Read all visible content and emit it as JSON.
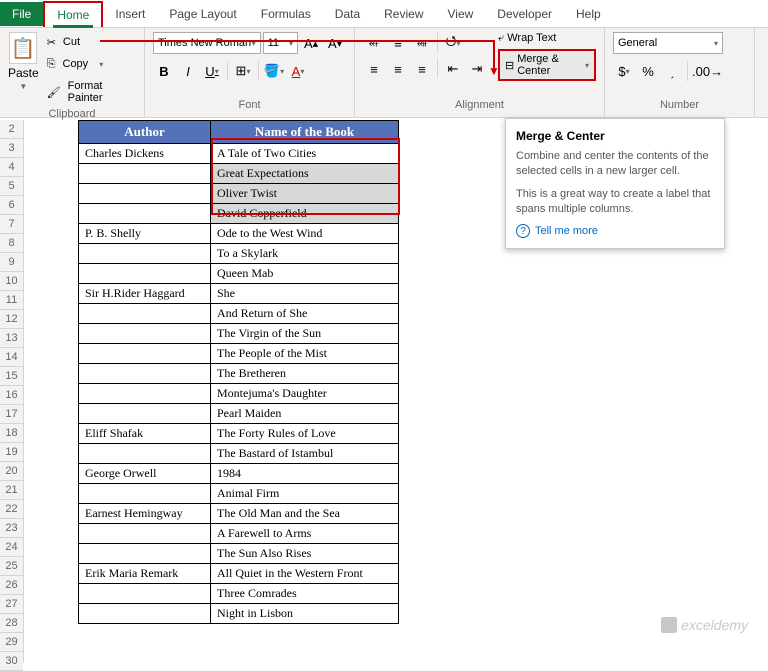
{
  "tabs": {
    "file": "File",
    "home": "Home",
    "insert": "Insert",
    "pagelayout": "Page Layout",
    "formulas": "Formulas",
    "data": "Data",
    "review": "Review",
    "view": "View",
    "developer": "Developer",
    "help": "Help"
  },
  "ribbon": {
    "clipboard": {
      "paste": "Paste",
      "cut": "Cut",
      "copy": "Copy",
      "fmtpainter": "Format Painter",
      "label": "Clipboard"
    },
    "font": {
      "name": "Times New Roman",
      "size": "11",
      "label": "Font"
    },
    "alignment": {
      "wraptext": "Wrap Text",
      "merge": "Merge & Center",
      "label": "Alignment"
    },
    "number": {
      "format": "General",
      "label": "Number"
    }
  },
  "tooltip": {
    "title": "Merge & Center",
    "line1": "Combine and center the contents of the selected cells in a new larger cell.",
    "line2": "This is a great way to create a label that spans multiple columns.",
    "tellmore": "Tell me more"
  },
  "table": {
    "h1": "Author",
    "h2": "Name of the Book",
    "rows": [
      [
        "Charles Dickens",
        "A Tale of Two Cities"
      ],
      [
        "",
        "Great Expectations"
      ],
      [
        "",
        "Oliver Twist"
      ],
      [
        "",
        "David Copperfield"
      ],
      [
        "P. B. Shelly",
        "Ode to the West Wind"
      ],
      [
        "",
        "To a Skylark"
      ],
      [
        "",
        "Queen Mab"
      ],
      [
        "Sir H.Rider Haggard",
        "She"
      ],
      [
        "",
        "And Return of She"
      ],
      [
        "",
        "The Virgin of the Sun"
      ],
      [
        "",
        "The People of the Mist"
      ],
      [
        "",
        "The Bretheren"
      ],
      [
        "",
        "Montejuma's Daughter"
      ],
      [
        "",
        "Pearl Maiden"
      ],
      [
        "Eliff Shafak",
        "The Forty Rules of Love"
      ],
      [
        "",
        "The Bastard of Istambul"
      ],
      [
        "George Orwell",
        "1984"
      ],
      [
        "",
        "Animal Firm"
      ],
      [
        "Earnest Hemingway",
        "The Old Man and the Sea"
      ],
      [
        "",
        "A Farewell to Arms"
      ],
      [
        "",
        "The Sun Also Rises"
      ],
      [
        "Erik Maria Remark",
        "All Quiet in the Western Front"
      ],
      [
        "",
        "Three Comrades"
      ],
      [
        "",
        "Night in Lisbon"
      ]
    ]
  },
  "rownums": [
    "2",
    "3",
    "4",
    "5",
    "6",
    "7",
    "8",
    "9",
    "10",
    "11",
    "12",
    "13",
    "14",
    "15",
    "16",
    "17",
    "18",
    "19",
    "20",
    "21",
    "22",
    "23",
    "24",
    "25",
    "26",
    "27",
    "28",
    "29",
    "30"
  ],
  "watermark": "exceldemy"
}
